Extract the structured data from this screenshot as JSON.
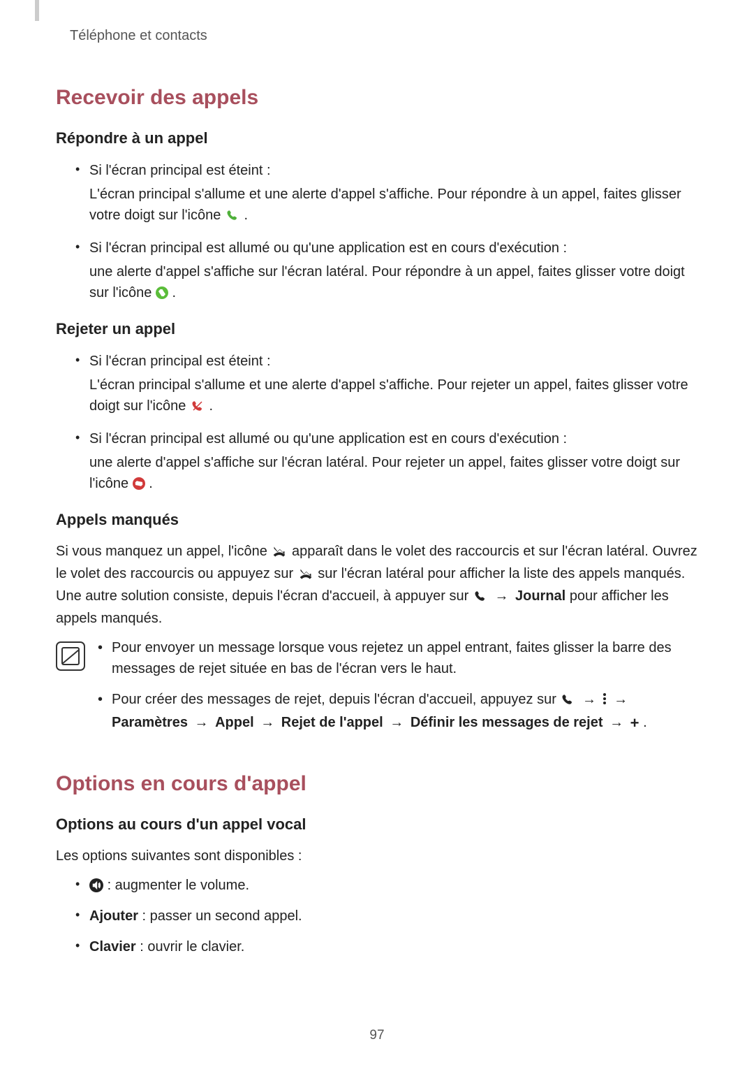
{
  "header": {
    "breadcrumb": "Téléphone et contacts"
  },
  "page_number": "97",
  "section1": {
    "title": "Recevoir des appels",
    "sub1": {
      "title": "Répondre à un appel",
      "items": [
        {
          "lead": "Si l'écran principal est éteint :",
          "body_a": "L'écran principal s'allume et une alerte d'appel s'affiche. Pour répondre à un appel, faites glisser votre doigt sur l'icône ",
          "body_b": "."
        },
        {
          "lead": "Si l'écran principal est allumé ou qu'une application est en cours d'exécution :",
          "body_a": "une alerte d'appel s'affiche sur l'écran latéral. Pour répondre à un appel, faites glisser votre doigt sur l'icône ",
          "body_b": "."
        }
      ]
    },
    "sub2": {
      "title": "Rejeter un appel",
      "items": [
        {
          "lead": "Si l'écran principal est éteint :",
          "body_a": "L'écran principal s'allume et une alerte d'appel s'affiche. Pour rejeter un appel, faites glisser votre doigt sur l'icône ",
          "body_b": "."
        },
        {
          "lead": "Si l'écran principal est allumé ou qu'une application est en cours d'exécution :",
          "body_a": "une alerte d'appel s'affiche sur l'écran latéral. Pour rejeter un appel, faites glisser votre doigt sur l'icône ",
          "body_b": "."
        }
      ]
    },
    "sub3": {
      "title": "Appels manqués",
      "para_a": "Si vous manquez un appel, l'icône ",
      "para_b": " apparaît dans le volet des raccourcis et sur l'écran latéral. Ouvrez le volet des raccourcis ou appuyez sur ",
      "para_c": " sur l'écran latéral pour afficher la liste des appels manqués. Une autre solution consiste, depuis l'écran d'accueil, à appuyer sur ",
      "arrow1": " → ",
      "journal": "Journal",
      "para_d": " pour afficher les appels manqués."
    },
    "notes": {
      "item1": "Pour envoyer un message lorsque vous rejetez un appel entrant, faites glisser la barre des messages de rejet située en bas de l'écran vers le haut.",
      "item2_a": "Pour créer des messages de rejet, depuis l'écran d'accueil, appuyez sur ",
      "arrow": " → ",
      "path1": "Paramètres",
      "path2": "Appel",
      "path3": "Rejet de l'appel",
      "path4": "Définir les messages de rejet",
      "dot": "."
    }
  },
  "section2": {
    "title": "Options en cours d'appel",
    "sub1": {
      "title": "Options au cours d'un appel vocal",
      "intro": "Les options suivantes sont disponibles :",
      "items": [
        {
          "text": " : augmenter le volume."
        },
        {
          "bold": "Ajouter",
          "text": " : passer un second appel."
        },
        {
          "bold": "Clavier",
          "text": " : ouvrir le clavier."
        }
      ]
    }
  }
}
